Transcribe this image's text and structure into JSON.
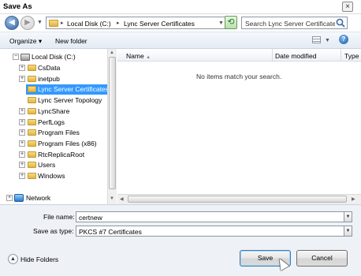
{
  "window": {
    "title": "Save As",
    "close_glyph": "×"
  },
  "address": {
    "crumbs": [
      "Local Disk (C:)",
      "Lync Server Certificates"
    ],
    "separator": "▸"
  },
  "search": {
    "placeholder": "Search Lync Server Certificates"
  },
  "toolbar": {
    "organize": "Organize",
    "new_folder": "New folder"
  },
  "nav_tree": [
    {
      "label": "Local Disk (C:)",
      "expander": "−",
      "type": "disk"
    },
    {
      "label": "CsData",
      "expander": "+",
      "type": "folder"
    },
    {
      "label": "inetpub",
      "expander": "+",
      "type": "folder"
    },
    {
      "label": "Lync Server Certificates",
      "expander": "",
      "type": "folder",
      "selected": true
    },
    {
      "label": "Lync Server Topology",
      "expander": "",
      "type": "folder"
    },
    {
      "label": "LyncShare",
      "expander": "+",
      "type": "folder"
    },
    {
      "label": "PerfLogs",
      "expander": "+",
      "type": "folder"
    },
    {
      "label": "Program Files",
      "expander": "+",
      "type": "folder"
    },
    {
      "label": "Program Files (x86)",
      "expander": "+",
      "type": "folder"
    },
    {
      "label": "RtcReplicaRoot",
      "expander": "+",
      "type": "folder"
    },
    {
      "label": "Users",
      "expander": "+",
      "type": "folder"
    },
    {
      "label": "Windows",
      "expander": "+",
      "type": "folder"
    },
    {
      "label": "Network",
      "expander": "+",
      "type": "network"
    }
  ],
  "file_list": {
    "columns": [
      "Name",
      "Date modified",
      "Type"
    ],
    "empty_message": "No items match your search."
  },
  "form": {
    "file_name_label": "File name:",
    "file_name_value": "certnew",
    "save_type_label": "Save as type:",
    "save_type_value": "PKCS #7 Certificates"
  },
  "buttons": {
    "hide_folders": "Hide Folders",
    "save": "Save",
    "cancel": "Cancel"
  },
  "colors": {
    "selection": "#3399ff",
    "toolbar_bg": "#e4ebf4",
    "bottom_bg": "#eef1f6"
  }
}
